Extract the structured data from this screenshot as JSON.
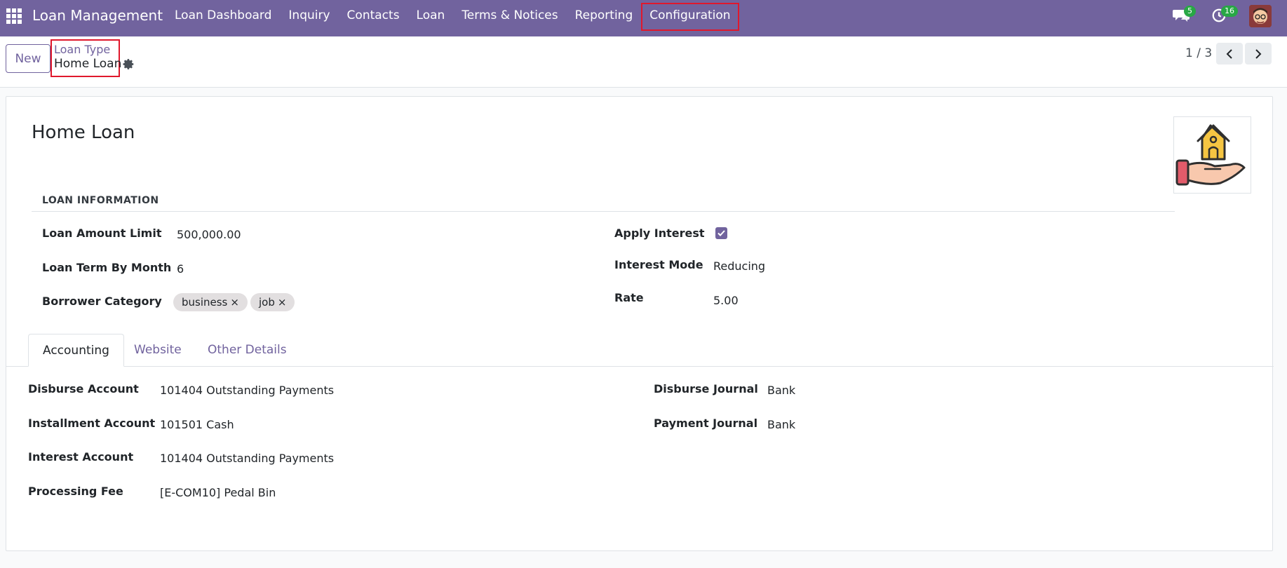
{
  "navbar": {
    "brand": "Loan Management",
    "menu": [
      "Loan Dashboard",
      "Inquiry",
      "Contacts",
      "Loan",
      "Terms & Notices",
      "Reporting",
      "Configuration"
    ],
    "messages_count": "5",
    "activities_count": "16"
  },
  "control": {
    "new_label": "New",
    "breadcrumb_parent": "Loan Type",
    "breadcrumb_current": "Home Loan",
    "pager": "1 / 3"
  },
  "form": {
    "title": "Home Loan",
    "section_title": "LOAN INFORMATION",
    "left_fields": [
      {
        "label": "Loan Amount Limit",
        "value": "500,000.00"
      },
      {
        "label": "Loan Term By Month",
        "value": "6"
      },
      {
        "label": "Borrower Category",
        "tags": [
          "business",
          "job"
        ]
      }
    ],
    "right_fields": [
      {
        "label": "Apply Interest",
        "checked": true
      },
      {
        "label": "Interest Mode",
        "value": "Reducing"
      },
      {
        "label": "Rate",
        "value": "5.00"
      }
    ],
    "tag_remove": "×",
    "tabs": [
      "Accounting",
      "Website",
      "Other Details"
    ],
    "accounting_left": [
      {
        "label": "Disburse Account",
        "value": "101404 Outstanding Payments"
      },
      {
        "label": "Installment Account",
        "value": "101501 Cash"
      },
      {
        "label": "Interest Account",
        "value": "101404 Outstanding Payments"
      },
      {
        "label": "Processing Fee",
        "value": "[E-COM10] Pedal Bin"
      }
    ],
    "accounting_right": [
      {
        "label": "Disburse Journal",
        "value": "Bank"
      },
      {
        "label": "Payment Journal",
        "value": "Bank"
      }
    ]
  },
  "colors": {
    "primary": "#71639e",
    "highlight": "#e0182c",
    "badge": "#28a745"
  },
  "icons": [
    "apps-icon",
    "chat-icon",
    "clock-icon",
    "gear-icon",
    "chevron-left-icon",
    "chevron-right-icon",
    "home-loan-image"
  ]
}
